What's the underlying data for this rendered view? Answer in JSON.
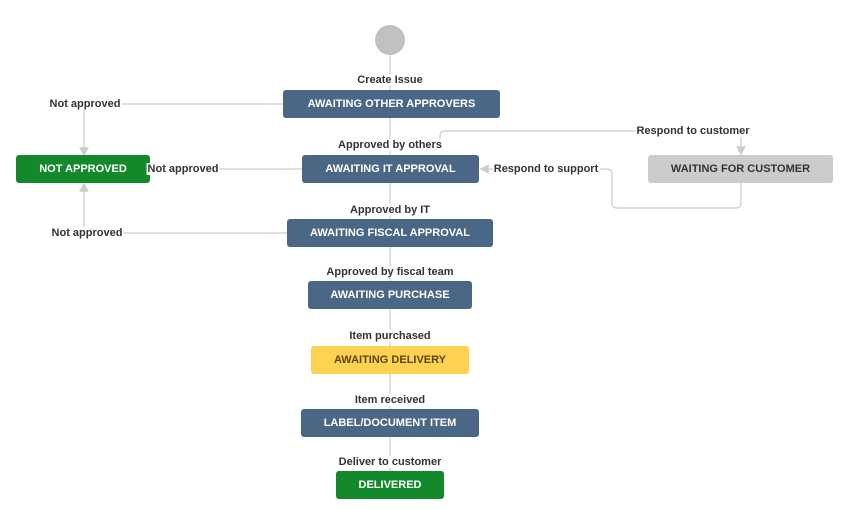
{
  "colors": {
    "in_progress": "#4a6785",
    "done": "#14892c",
    "waiting": "#cccccc",
    "delivery": "#ffd351",
    "line": "#cccccc"
  },
  "start": {
    "icon": "start-circle-icon"
  },
  "statuses": {
    "awaiting_other_approvers": "AWAITING OTHER APPROVERS",
    "not_approved": "NOT APPROVED",
    "awaiting_it_approval": "AWAITING IT APPROVAL",
    "waiting_for_customer": "WAITING FOR CUSTOMER",
    "awaiting_fiscal_approval": "AWAITING FISCAL APPROVAL",
    "awaiting_purchase": "AWAITING PURCHASE",
    "awaiting_delivery": "AWAITING DELIVERY",
    "label_document_item": "LABEL/DOCUMENT ITEM",
    "delivered": "DELIVERED"
  },
  "transitions": {
    "create_issue": "Create Issue",
    "not_approved_1": "Not approved",
    "approved_by_others": "Approved by others",
    "respond_to_customer": "Respond to customer",
    "not_approved_2": "Not approved",
    "respond_to_support": "Respond to support",
    "approved_by_it": "Approved by IT",
    "not_approved_3": "Not approved",
    "approved_by_fiscal_team": "Approved by fiscal team",
    "item_purchased": "Item purchased",
    "item_received": "Item received",
    "deliver_to_customer": "Deliver to customer"
  }
}
